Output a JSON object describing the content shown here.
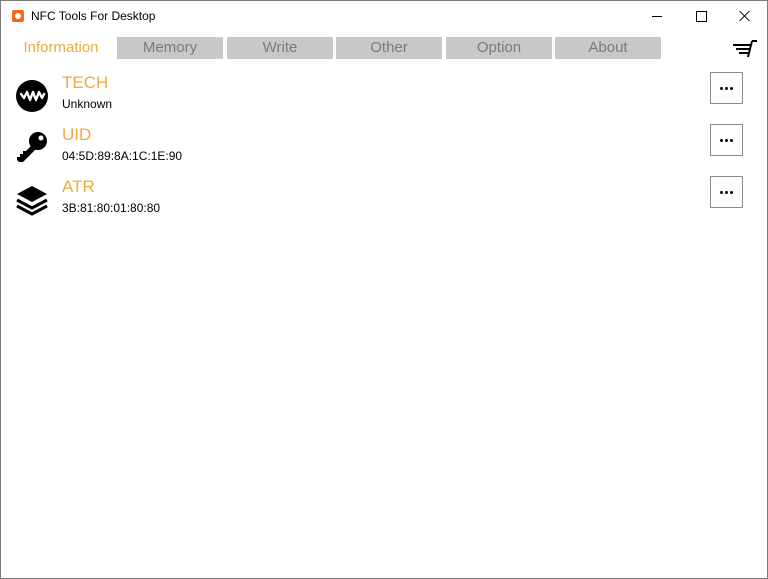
{
  "window": {
    "title": "NFC Tools For Desktop"
  },
  "tabs": [
    {
      "label": "Information",
      "active": true
    },
    {
      "label": "Memory",
      "active": false
    },
    {
      "label": "Write",
      "active": false
    },
    {
      "label": "Other",
      "active": false
    },
    {
      "label": "Option",
      "active": false
    },
    {
      "label": "About",
      "active": false
    }
  ],
  "info_rows": [
    {
      "label": "TECH",
      "value": "Unknown",
      "icon": "wave-icon"
    },
    {
      "label": "UID",
      "value": "04:5D:89:8A:1C:1E:90",
      "icon": "key-icon"
    },
    {
      "label": "ATR",
      "value": "3B:81:80:01:80:80",
      "icon": "layers-icon"
    }
  ],
  "colors": {
    "accent": "#f2a93b",
    "tab_inactive_bg": "#c8c8c8",
    "tab_inactive_text": "#7a7a7a",
    "app_icon": "#f26b21"
  }
}
